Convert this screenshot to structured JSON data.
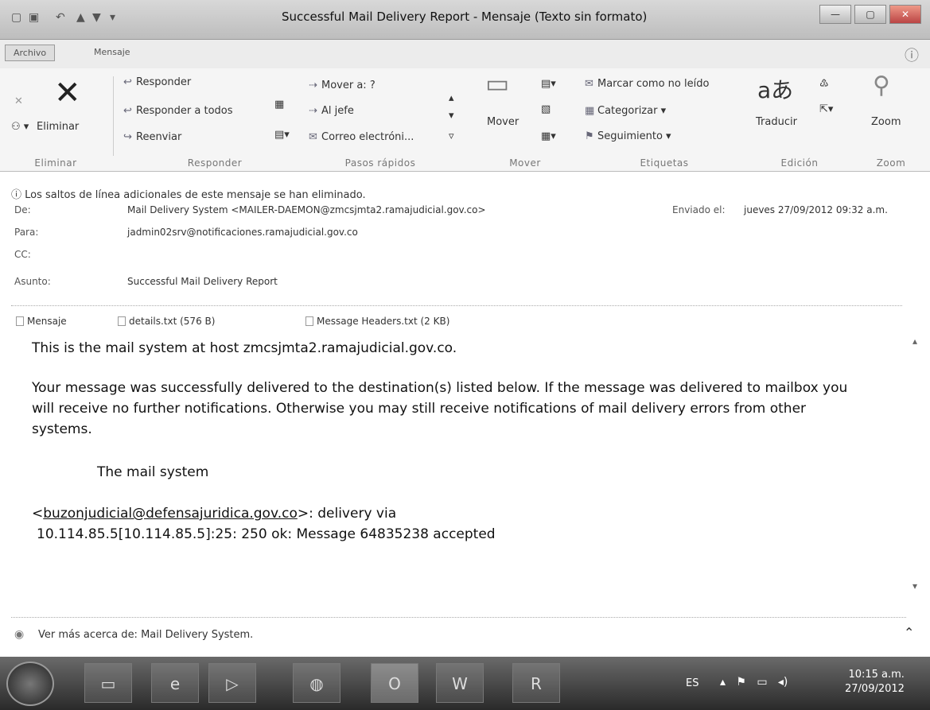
{
  "window": {
    "title": "Successful Mail Delivery Report - Mensaje (Texto sin formato)"
  },
  "tabs": {
    "file": "Archivo",
    "message": "Mensaje"
  },
  "ribbon": {
    "delete": {
      "button": "Eliminar",
      "group": "Eliminar"
    },
    "respond": {
      "reply": "Responder",
      "reply_all": "Responder a todos",
      "forward": "Reenviar",
      "group": "Responder"
    },
    "quick_steps": {
      "move_to": "Mover a: ?",
      "to_boss": "Al jefe",
      "email": "Correo electróni...",
      "group": "Pasos rápidos"
    },
    "move": {
      "button": "Mover",
      "group": "Mover"
    },
    "tags": {
      "mark_unread": "Marcar como no leído",
      "categorize": "Categorizar",
      "follow_up": "Seguimiento",
      "group": "Etiquetas"
    },
    "editing": {
      "translate": "Traducir",
      "group": "Edición"
    },
    "zoom": {
      "button": "Zoom",
      "group": "Zoom"
    }
  },
  "info_bar": "Los saltos de línea adicionales de este mensaje se han eliminado.",
  "header": {
    "from_label": "De:",
    "from": "Mail Delivery System <MAILER-DAEMON@zmcsjmta2.ramajudicial.gov.co>",
    "sent_label": "Enviado el:",
    "sent": "jueves 27/09/2012 09:32 a.m.",
    "to_label": "Para:",
    "to": "jadmin02srv@notificaciones.ramajudicial.gov.co",
    "cc_label": "CC:",
    "subject_label": "Asunto:",
    "subject": "Successful Mail Delivery Report"
  },
  "attachments": {
    "message": "Mensaje",
    "details": "details.txt (576 B)",
    "headers": "Message Headers.txt (2 KB)"
  },
  "body": {
    "line1": "This is the mail system at host zmcsjmta2.ramajudicial.gov.co.",
    "para2_l1": "Your message was successfully delivered to the destination(s) listed below. If the message was delivered to mailbox you",
    "para2_l2": "will receive no further notifications. Otherwise you may still receive notifications of mail delivery errors from other",
    "para2_l3": "systems.",
    "sig": "The mail system",
    "addr_open": "<",
    "addr_link": "buzonjudicial@defensajuridica.gov.co",
    "addr_rest": ">: delivery via",
    "relay": "10.114.85.5[10.114.85.5]:25: 250 ok:  Message 64835238 accepted"
  },
  "people_pane": "Ver más acerca de: Mail Delivery System.",
  "taskbar": {
    "lang": "ES",
    "time": "10:15 a.m.",
    "date": "27/09/2012"
  }
}
